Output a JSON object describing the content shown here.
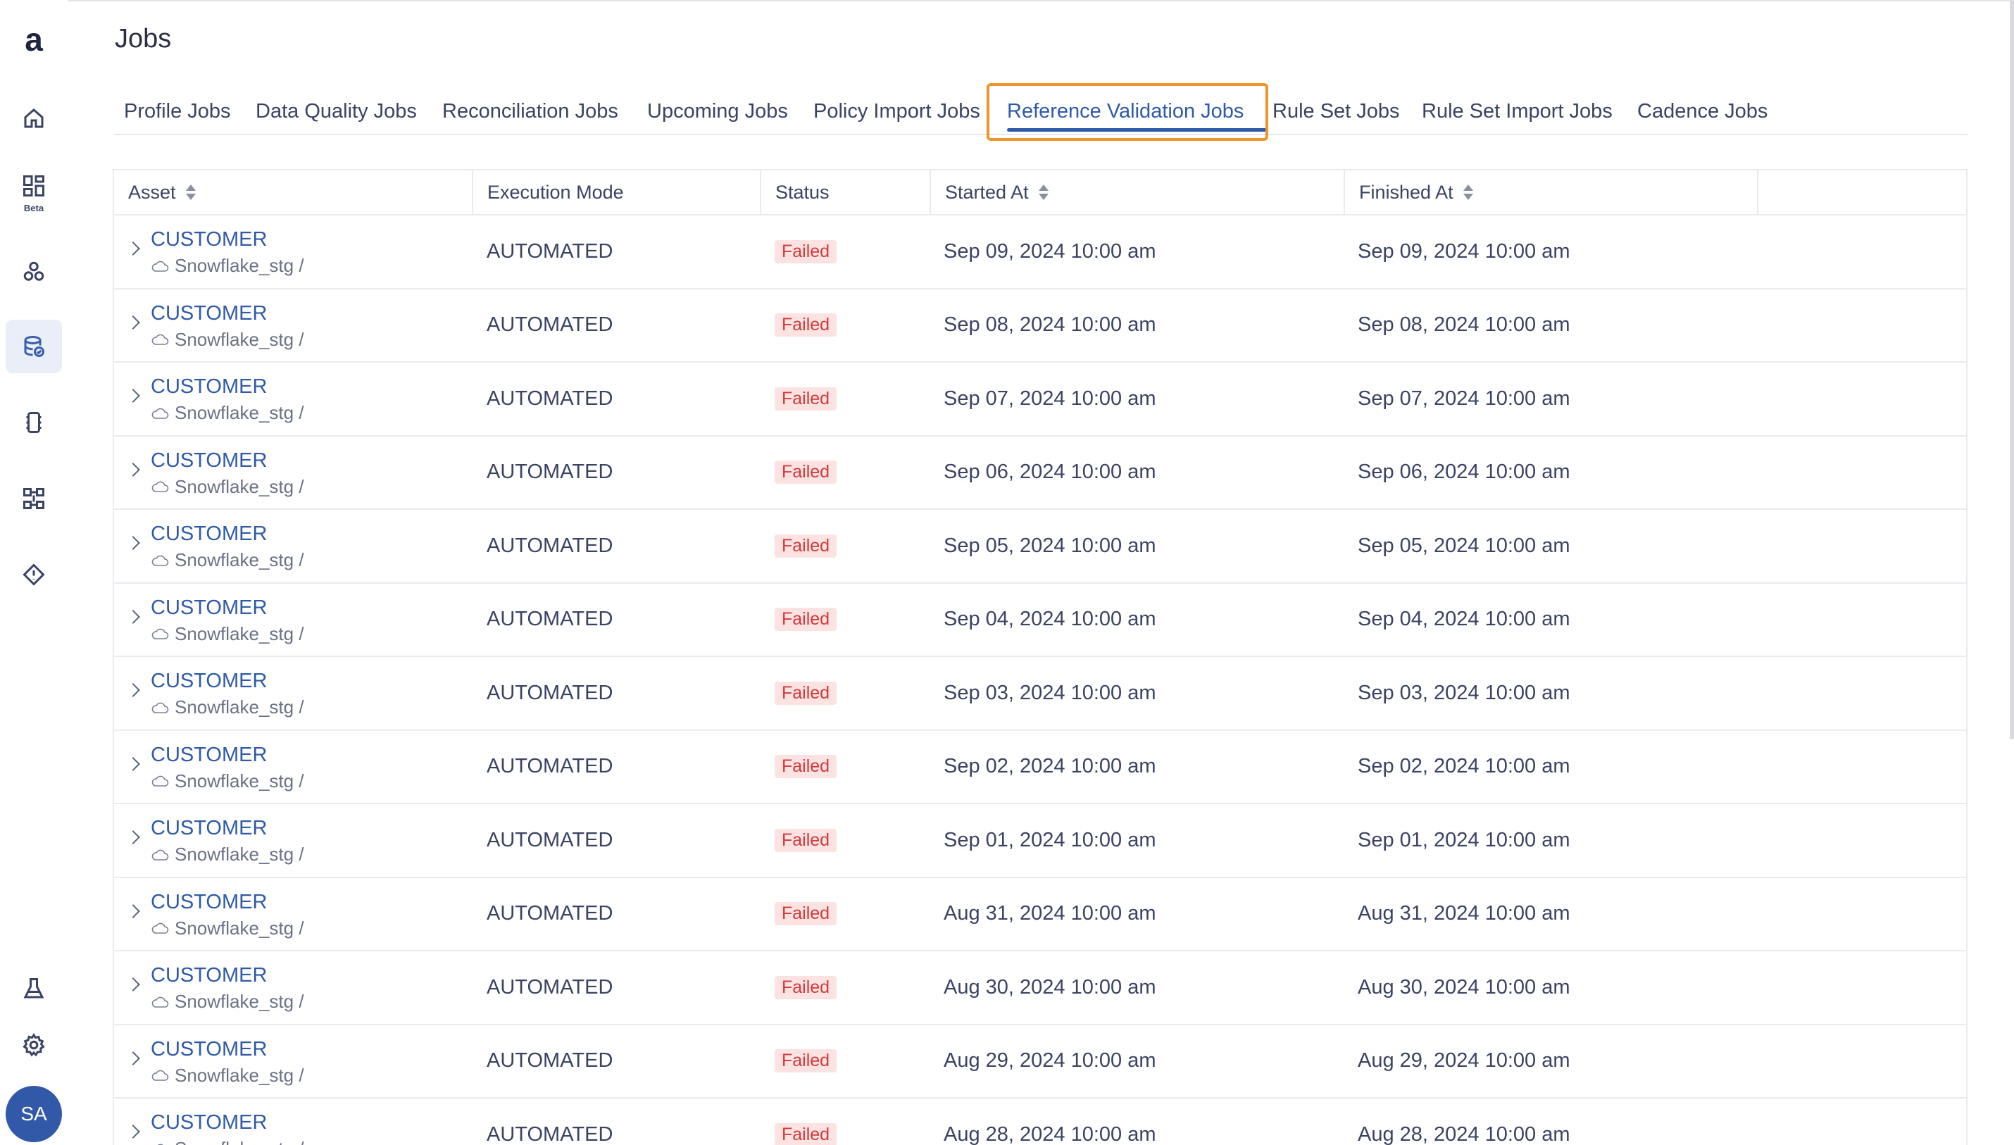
{
  "app": {
    "title": "Jobs",
    "logo_letter": "a",
    "beta_label": "Beta",
    "user_initials": "SA"
  },
  "sidebar": {
    "items": [
      {
        "icon": "home-icon"
      },
      {
        "icon": "dashboard-icon",
        "badge": "Beta"
      },
      {
        "icon": "hierarchy-icon"
      },
      {
        "icon": "data-reliability-icon",
        "active": true
      },
      {
        "icon": "pipeline-icon"
      },
      {
        "icon": "integrations-icon"
      },
      {
        "icon": "alert-icon"
      },
      {
        "icon": "lab-icon"
      },
      {
        "icon": "settings-icon"
      }
    ]
  },
  "tabs": [
    {
      "label": "Profile Jobs"
    },
    {
      "label": "Data Quality Jobs"
    },
    {
      "label": "Reconciliation Jobs"
    },
    {
      "label": "Upcoming Jobs"
    },
    {
      "label": "Policy Import Jobs"
    },
    {
      "label": "Reference Validation Jobs",
      "active": true
    },
    {
      "label": "Rule Set Jobs"
    },
    {
      "label": "Rule Set Import Jobs"
    },
    {
      "label": "Cadence Jobs"
    }
  ],
  "table": {
    "columns": [
      "Asset",
      "Execution Mode",
      "Status",
      "Started At",
      "Finished At",
      ""
    ],
    "rows": [
      {
        "asset": "CUSTOMER",
        "source": "Snowflake_stg /",
        "mode": "AUTOMATED",
        "status": "Failed",
        "started": "Sep 09, 2024 10:00 am",
        "finished": "Sep 09, 2024 10:00 am"
      },
      {
        "asset": "CUSTOMER",
        "source": "Snowflake_stg /",
        "mode": "AUTOMATED",
        "status": "Failed",
        "started": "Sep 08, 2024 10:00 am",
        "finished": "Sep 08, 2024 10:00 am"
      },
      {
        "asset": "CUSTOMER",
        "source": "Snowflake_stg /",
        "mode": "AUTOMATED",
        "status": "Failed",
        "started": "Sep 07, 2024 10:00 am",
        "finished": "Sep 07, 2024 10:00 am"
      },
      {
        "asset": "CUSTOMER",
        "source": "Snowflake_stg /",
        "mode": "AUTOMATED",
        "status": "Failed",
        "started": "Sep 06, 2024 10:00 am",
        "finished": "Sep 06, 2024 10:00 am"
      },
      {
        "asset": "CUSTOMER",
        "source": "Snowflake_stg /",
        "mode": "AUTOMATED",
        "status": "Failed",
        "started": "Sep 05, 2024 10:00 am",
        "finished": "Sep 05, 2024 10:00 am"
      },
      {
        "asset": "CUSTOMER",
        "source": "Snowflake_stg /",
        "mode": "AUTOMATED",
        "status": "Failed",
        "started": "Sep 04, 2024 10:00 am",
        "finished": "Sep 04, 2024 10:00 am"
      },
      {
        "asset": "CUSTOMER",
        "source": "Snowflake_stg /",
        "mode": "AUTOMATED",
        "status": "Failed",
        "started": "Sep 03, 2024 10:00 am",
        "finished": "Sep 03, 2024 10:00 am"
      },
      {
        "asset": "CUSTOMER",
        "source": "Snowflake_stg /",
        "mode": "AUTOMATED",
        "status": "Failed",
        "started": "Sep 02, 2024 10:00 am",
        "finished": "Sep 02, 2024 10:00 am"
      },
      {
        "asset": "CUSTOMER",
        "source": "Snowflake_stg /",
        "mode": "AUTOMATED",
        "status": "Failed",
        "started": "Sep 01, 2024 10:00 am",
        "finished": "Sep 01, 2024 10:00 am"
      },
      {
        "asset": "CUSTOMER",
        "source": "Snowflake_stg /",
        "mode": "AUTOMATED",
        "status": "Failed",
        "started": "Aug 31, 2024 10:00 am",
        "finished": "Aug 31, 2024 10:00 am"
      },
      {
        "asset": "CUSTOMER",
        "source": "Snowflake_stg /",
        "mode": "AUTOMATED",
        "status": "Failed",
        "started": "Aug 30, 2024 10:00 am",
        "finished": "Aug 30, 2024 10:00 am"
      },
      {
        "asset": "CUSTOMER",
        "source": "Snowflake_stg /",
        "mode": "AUTOMATED",
        "status": "Failed",
        "started": "Aug 29, 2024 10:00 am",
        "finished": "Aug 29, 2024 10:00 am"
      },
      {
        "asset": "CUSTOMER",
        "source": "Snowflake_stg /",
        "mode": "AUTOMATED",
        "status": "Failed",
        "started": "Aug 28, 2024 10:00 am",
        "finished": "Aug 28, 2024 10:00 am"
      }
    ]
  },
  "colors": {
    "accent": "#2f5aa8",
    "highlight": "#f0932a",
    "failed_bg": "#fde2e2",
    "failed_text": "#d23a3a"
  }
}
